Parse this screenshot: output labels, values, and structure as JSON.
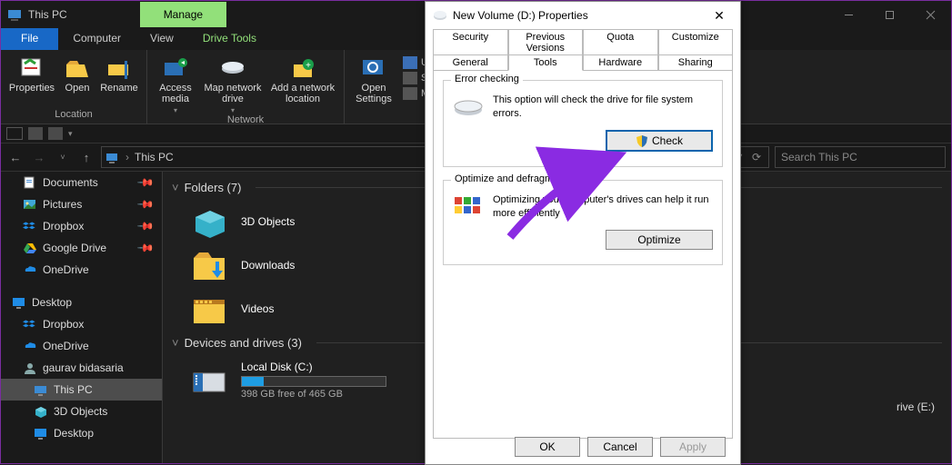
{
  "window": {
    "title": "This PC",
    "contextTab": "Manage",
    "controls": {
      "min": "–",
      "max": "☐",
      "close": "✕"
    }
  },
  "ribbonTabs": {
    "file": "File",
    "computer": "Computer",
    "view": "View",
    "drive": "Drive Tools"
  },
  "ribbon": {
    "location": {
      "properties": "Properties",
      "open": "Open",
      "rename": "Rename",
      "groupLabel": "Location"
    },
    "network": {
      "accessMedia": "Access media",
      "mapDrive": "Map network drive",
      "addLoc": "Add a network location",
      "groupLabel": "Network"
    },
    "system": {
      "openSettings": "Open Settings",
      "uninstall": "U",
      "sysprops": "Sy",
      "manage": "M"
    }
  },
  "nav": {
    "back": "←",
    "fwd": "→",
    "up": "↑",
    "path": "This PC",
    "searchPlaceholder": "Search This PC",
    "refresh": "⟳",
    "dd": "˅"
  },
  "sidebar": {
    "items": [
      {
        "label": "Documents",
        "icon": "doc",
        "pin": true
      },
      {
        "label": "Pictures",
        "icon": "pic",
        "pin": true
      },
      {
        "label": "Dropbox",
        "icon": "dbx",
        "pin": true
      },
      {
        "label": "Google Drive",
        "icon": "gdrv",
        "pin": true
      },
      {
        "label": "OneDrive",
        "icon": "od"
      },
      {
        "label": "Desktop",
        "icon": "desk",
        "top": true
      },
      {
        "label": "Dropbox",
        "icon": "dbx"
      },
      {
        "label": "OneDrive",
        "icon": "od"
      },
      {
        "label": "gaurav bidasaria",
        "icon": "user"
      },
      {
        "label": "This PC",
        "icon": "pc",
        "selected": true
      },
      {
        "label": "3D Objects",
        "icon": "3d"
      },
      {
        "label": "Desktop",
        "icon": "desk"
      }
    ]
  },
  "content": {
    "foldersHeader": "Folders (7)",
    "folders": [
      {
        "label": "3D Objects"
      },
      {
        "label": "Downloads"
      },
      {
        "label": "Videos"
      }
    ],
    "devicesHeader": "Devices and drives (3)",
    "localDisk": {
      "label": "Local Disk (C:)",
      "sub": "398 GB free of 465 GB",
      "fillPct": 15
    },
    "otherDrive": "rive (E:)"
  },
  "dialog": {
    "title": "New Volume (D:) Properties",
    "tabsTop": [
      "Security",
      "Previous Versions",
      "Quota",
      "Customize"
    ],
    "tabsBot": [
      "General",
      "Tools",
      "Hardware",
      "Sharing"
    ],
    "activeTab": "Tools",
    "errorChecking": {
      "legend": "Error checking",
      "msg": "This option will check the drive for file system errors.",
      "button": "Check"
    },
    "optimize": {
      "legend": "Optimize and defragment drive",
      "msg": "Optimizing your computer's drives can help it run more efficiently",
      "button": "Optimize"
    },
    "footer": {
      "ok": "OK",
      "cancel": "Cancel",
      "apply": "Apply"
    }
  }
}
